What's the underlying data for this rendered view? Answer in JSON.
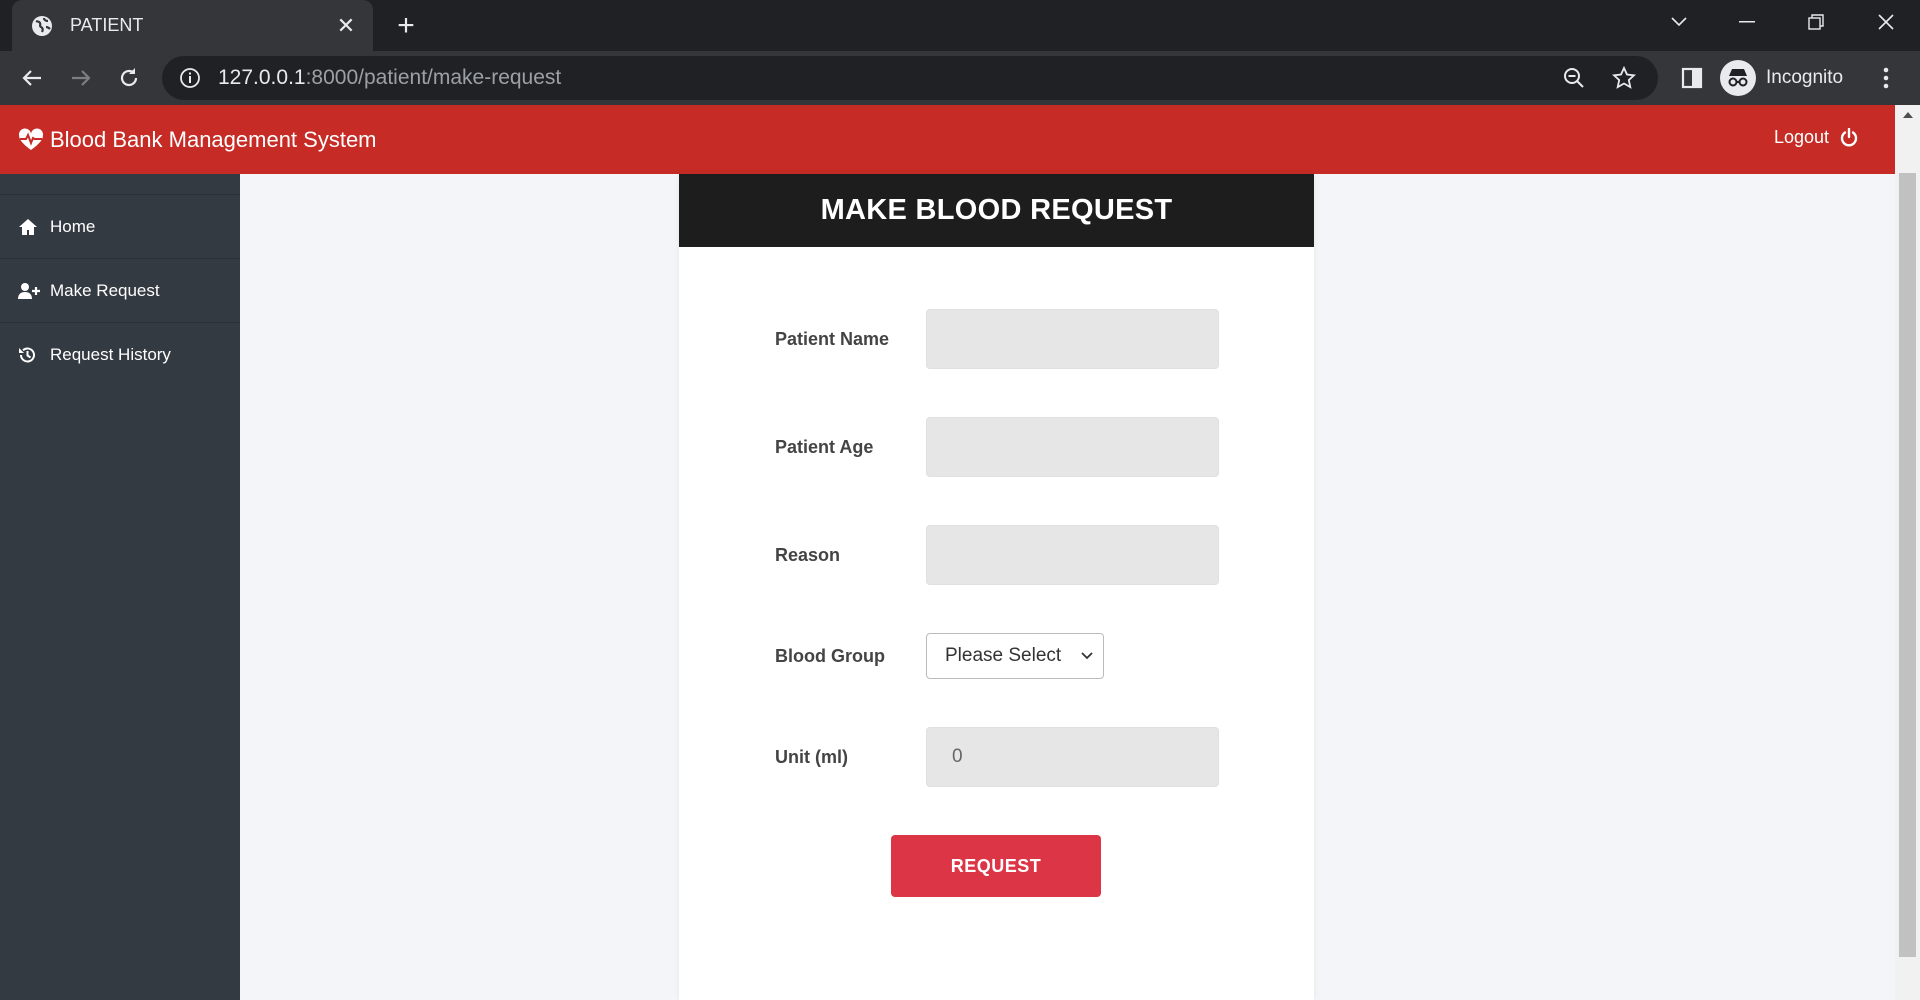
{
  "browser": {
    "tab_title": "PATIENT",
    "url_host": "127.0.0.1",
    "url_rest": ":8000/patient/make-request",
    "profile_label": "Incognito"
  },
  "app": {
    "brand": "Blood Bank Management System",
    "logout_label": "Logout",
    "accent_color": "#c62b25"
  },
  "sidebar": {
    "items": [
      {
        "label": "Home",
        "icon": "home-icon"
      },
      {
        "label": "Make Request",
        "icon": "user-plus-icon"
      },
      {
        "label": "Request History",
        "icon": "history-icon"
      }
    ]
  },
  "form": {
    "title": "MAKE BLOOD REQUEST",
    "patient_name_label": "Patient Name",
    "patient_name_value": "",
    "patient_age_label": "Patient Age",
    "patient_age_value": "",
    "reason_label": "Reason",
    "reason_value": "",
    "blood_group_label": "Blood Group",
    "blood_group_selected": "Please Select",
    "unit_label": "Unit (ml)",
    "unit_value": "0",
    "submit_label": "REQUEST"
  }
}
